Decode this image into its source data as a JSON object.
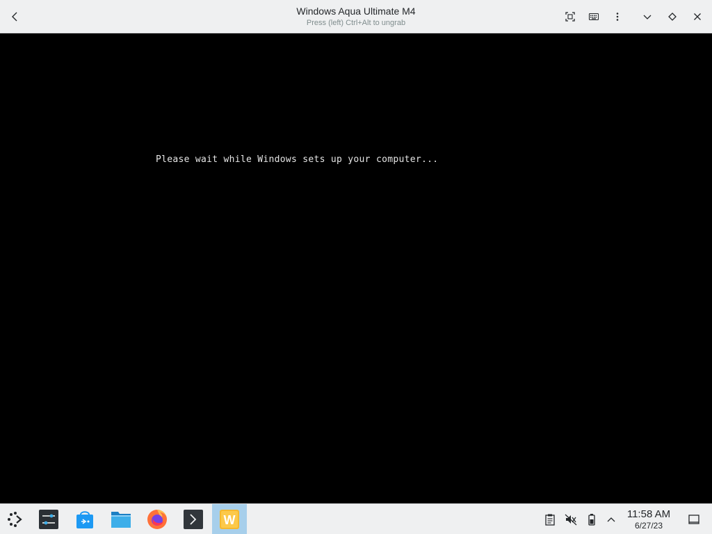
{
  "window": {
    "title": "Windows Aqua Ultimate M4",
    "subtitle": "Press (left) Ctrl+Alt to ungrab"
  },
  "titlebar_buttons": {
    "back": "back-icon",
    "fullscreen": "fullscreen-icon",
    "keyboard": "keyboard-icon",
    "menu": "kebab-menu-icon",
    "minimize": "chevron-down-icon",
    "maximize": "diamond-icon",
    "close": "close-icon"
  },
  "vm": {
    "message": "Please wait while Windows sets up your computer..."
  },
  "taskbar": {
    "apps": [
      {
        "name": "app-launcher",
        "icon": "launcher-icon"
      },
      {
        "name": "system-settings",
        "icon": "settings-icon"
      },
      {
        "name": "discover",
        "icon": "discover-icon"
      },
      {
        "name": "file-manager",
        "icon": "folder-icon"
      },
      {
        "name": "firefox",
        "icon": "firefox-icon"
      },
      {
        "name": "terminal",
        "icon": "terminal-icon"
      },
      {
        "name": "vm-window",
        "icon": "w-icon",
        "letter": "W"
      }
    ],
    "tray": [
      "clipboard-icon",
      "muted-speaker-icon",
      "battery-icon",
      "chevron-up-icon"
    ],
    "clock": {
      "time": "11:58 AM",
      "date": "6/27/23"
    },
    "show_desktop": "show-desktop-icon"
  },
  "colors": {
    "bar_bg": "#eff0f1",
    "active_task": "#a7cfeb",
    "screen_bg": "#000000",
    "text": "#232629"
  }
}
